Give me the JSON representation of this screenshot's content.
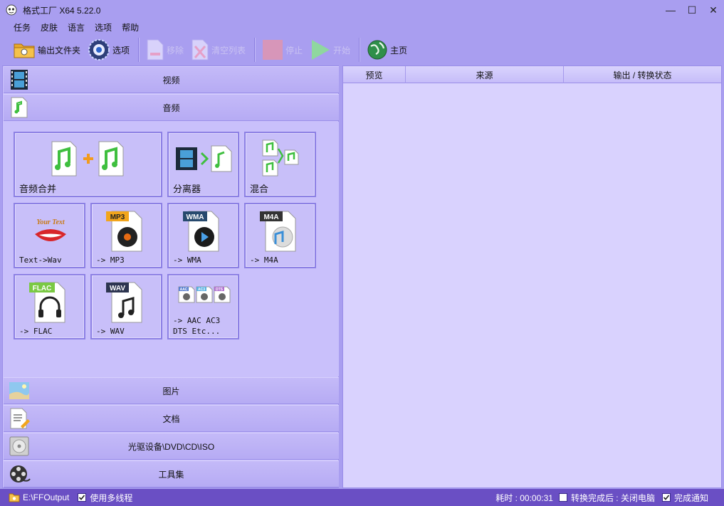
{
  "window": {
    "title": "格式工厂 X64 5.22.0",
    "minimize": "—",
    "maximize": "☐",
    "close": "✕"
  },
  "menu": [
    "任务",
    "皮肤",
    "语言",
    "选项",
    "帮助"
  ],
  "toolbar": {
    "output_folder": "输出文件夹",
    "options": "选项",
    "remove": "移除",
    "clear_list": "清空列表",
    "stop": "停止",
    "start": "开始",
    "home": "主页"
  },
  "categories": {
    "video": "视频",
    "audio": "音频",
    "picture": "图片",
    "document": "文档",
    "rom": "光驱设备\\DVD\\CD\\ISO",
    "tools": "工具集"
  },
  "audio_tiles": {
    "joiner": "音频合并",
    "splitter": "分离器",
    "mix": "混合",
    "text_wav": "Text->Wav",
    "text_wav_art": "Your Text",
    "mp3": "-> MP3",
    "wma": "-> WMA",
    "m4a": "-> M4A",
    "flac": "-> FLAC",
    "wav": "-> WAV",
    "other_line1": "-> AAC AC3",
    "other_line2": "DTS Etc...",
    "badge_mp3": "MP3",
    "badge_wma": "WMA",
    "badge_m4a": "M4A",
    "badge_flac": "FLAC",
    "badge_wav": "WAV",
    "badge_aac": "AAC",
    "badge_ac3": "AC3",
    "badge_dts": "DTS"
  },
  "task_table": {
    "columns": [
      "预览",
      "来源",
      "输出 / 转换状态"
    ]
  },
  "status": {
    "output_path": "E:\\FFOutput",
    "multithread": "使用多线程",
    "elapsed": "耗时 : 00:00:31",
    "after_done": "转换完成后 : 关闭电脑",
    "notify": "完成通知"
  },
  "colors": {
    "accent": "#6a4fc4",
    "panel": "#c9c0fb",
    "music_green": "#3fbf3f"
  }
}
